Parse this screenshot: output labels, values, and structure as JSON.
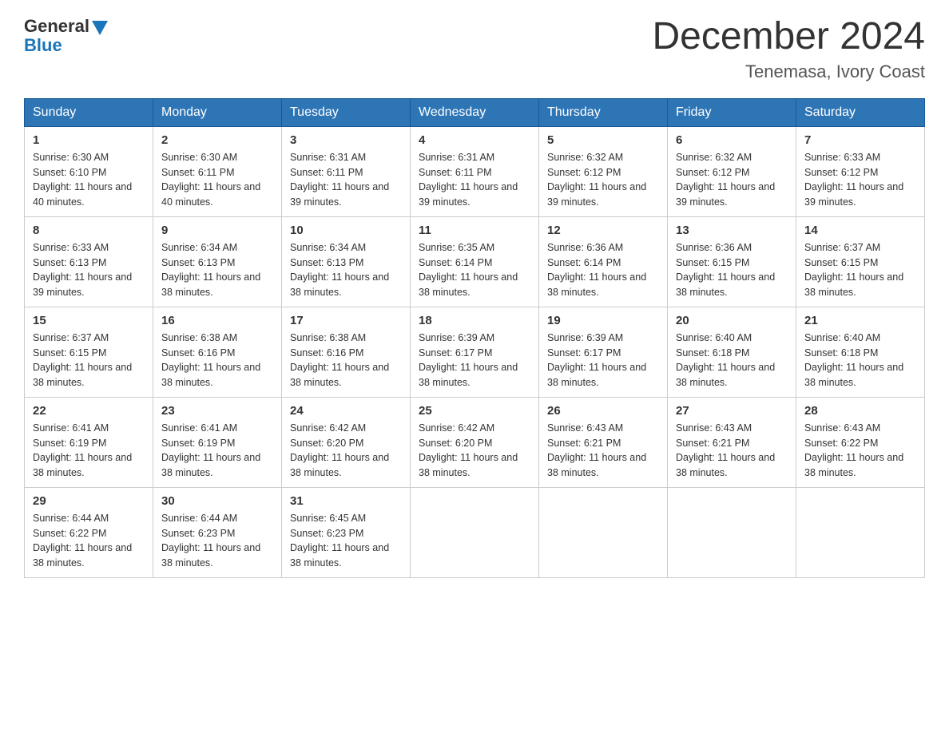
{
  "logo": {
    "general": "General",
    "blue": "Blue"
  },
  "title": "December 2024",
  "location": "Tenemasa, Ivory Coast",
  "days_of_week": [
    "Sunday",
    "Monday",
    "Tuesday",
    "Wednesday",
    "Thursday",
    "Friday",
    "Saturday"
  ],
  "weeks": [
    [
      {
        "day": 1,
        "sunrise": "6:30 AM",
        "sunset": "6:10 PM",
        "daylight": "11 hours and 40 minutes."
      },
      {
        "day": 2,
        "sunrise": "6:30 AM",
        "sunset": "6:11 PM",
        "daylight": "11 hours and 40 minutes."
      },
      {
        "day": 3,
        "sunrise": "6:31 AM",
        "sunset": "6:11 PM",
        "daylight": "11 hours and 39 minutes."
      },
      {
        "day": 4,
        "sunrise": "6:31 AM",
        "sunset": "6:11 PM",
        "daylight": "11 hours and 39 minutes."
      },
      {
        "day": 5,
        "sunrise": "6:32 AM",
        "sunset": "6:12 PM",
        "daylight": "11 hours and 39 minutes."
      },
      {
        "day": 6,
        "sunrise": "6:32 AM",
        "sunset": "6:12 PM",
        "daylight": "11 hours and 39 minutes."
      },
      {
        "day": 7,
        "sunrise": "6:33 AM",
        "sunset": "6:12 PM",
        "daylight": "11 hours and 39 minutes."
      }
    ],
    [
      {
        "day": 8,
        "sunrise": "6:33 AM",
        "sunset": "6:13 PM",
        "daylight": "11 hours and 39 minutes."
      },
      {
        "day": 9,
        "sunrise": "6:34 AM",
        "sunset": "6:13 PM",
        "daylight": "11 hours and 38 minutes."
      },
      {
        "day": 10,
        "sunrise": "6:34 AM",
        "sunset": "6:13 PM",
        "daylight": "11 hours and 38 minutes."
      },
      {
        "day": 11,
        "sunrise": "6:35 AM",
        "sunset": "6:14 PM",
        "daylight": "11 hours and 38 minutes."
      },
      {
        "day": 12,
        "sunrise": "6:36 AM",
        "sunset": "6:14 PM",
        "daylight": "11 hours and 38 minutes."
      },
      {
        "day": 13,
        "sunrise": "6:36 AM",
        "sunset": "6:15 PM",
        "daylight": "11 hours and 38 minutes."
      },
      {
        "day": 14,
        "sunrise": "6:37 AM",
        "sunset": "6:15 PM",
        "daylight": "11 hours and 38 minutes."
      }
    ],
    [
      {
        "day": 15,
        "sunrise": "6:37 AM",
        "sunset": "6:15 PM",
        "daylight": "11 hours and 38 minutes."
      },
      {
        "day": 16,
        "sunrise": "6:38 AM",
        "sunset": "6:16 PM",
        "daylight": "11 hours and 38 minutes."
      },
      {
        "day": 17,
        "sunrise": "6:38 AM",
        "sunset": "6:16 PM",
        "daylight": "11 hours and 38 minutes."
      },
      {
        "day": 18,
        "sunrise": "6:39 AM",
        "sunset": "6:17 PM",
        "daylight": "11 hours and 38 minutes."
      },
      {
        "day": 19,
        "sunrise": "6:39 AM",
        "sunset": "6:17 PM",
        "daylight": "11 hours and 38 minutes."
      },
      {
        "day": 20,
        "sunrise": "6:40 AM",
        "sunset": "6:18 PM",
        "daylight": "11 hours and 38 minutes."
      },
      {
        "day": 21,
        "sunrise": "6:40 AM",
        "sunset": "6:18 PM",
        "daylight": "11 hours and 38 minutes."
      }
    ],
    [
      {
        "day": 22,
        "sunrise": "6:41 AM",
        "sunset": "6:19 PM",
        "daylight": "11 hours and 38 minutes."
      },
      {
        "day": 23,
        "sunrise": "6:41 AM",
        "sunset": "6:19 PM",
        "daylight": "11 hours and 38 minutes."
      },
      {
        "day": 24,
        "sunrise": "6:42 AM",
        "sunset": "6:20 PM",
        "daylight": "11 hours and 38 minutes."
      },
      {
        "day": 25,
        "sunrise": "6:42 AM",
        "sunset": "6:20 PM",
        "daylight": "11 hours and 38 minutes."
      },
      {
        "day": 26,
        "sunrise": "6:43 AM",
        "sunset": "6:21 PM",
        "daylight": "11 hours and 38 minutes."
      },
      {
        "day": 27,
        "sunrise": "6:43 AM",
        "sunset": "6:21 PM",
        "daylight": "11 hours and 38 minutes."
      },
      {
        "day": 28,
        "sunrise": "6:43 AM",
        "sunset": "6:22 PM",
        "daylight": "11 hours and 38 minutes."
      }
    ],
    [
      {
        "day": 29,
        "sunrise": "6:44 AM",
        "sunset": "6:22 PM",
        "daylight": "11 hours and 38 minutes."
      },
      {
        "day": 30,
        "sunrise": "6:44 AM",
        "sunset": "6:23 PM",
        "daylight": "11 hours and 38 minutes."
      },
      {
        "day": 31,
        "sunrise": "6:45 AM",
        "sunset": "6:23 PM",
        "daylight": "11 hours and 38 minutes."
      },
      null,
      null,
      null,
      null
    ]
  ],
  "labels": {
    "sunrise": "Sunrise:",
    "sunset": "Sunset:",
    "daylight": "Daylight:"
  }
}
